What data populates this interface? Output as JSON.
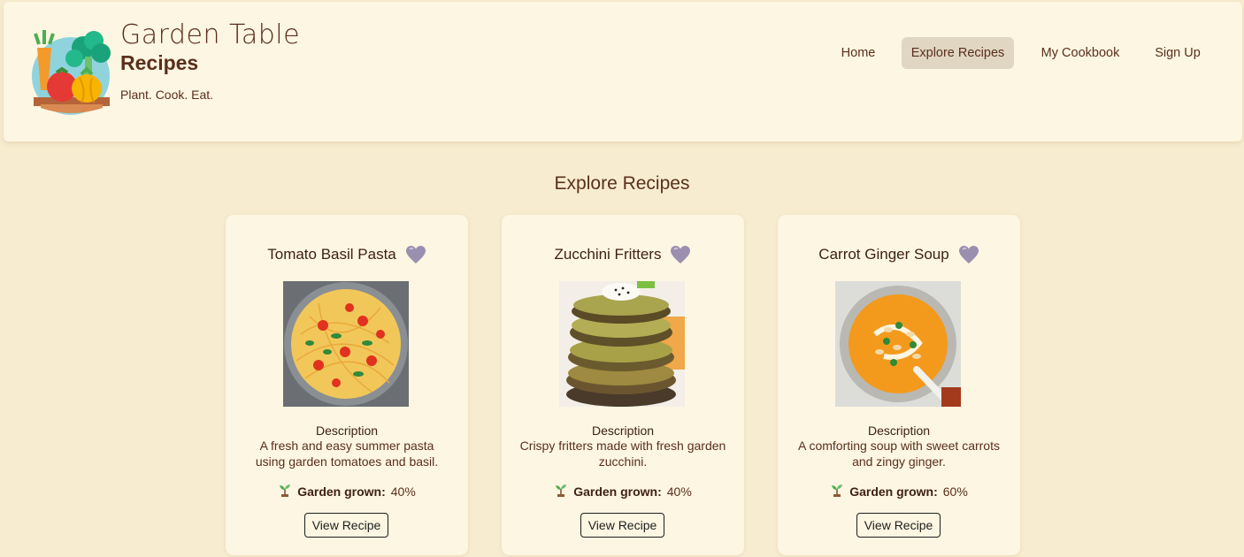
{
  "brand": {
    "title": "Garden Table",
    "subtitle": "Recipes",
    "tagline": "Plant. Cook. Eat."
  },
  "nav": [
    {
      "label": "Home",
      "active": false
    },
    {
      "label": "Explore Recipes",
      "active": true
    },
    {
      "label": "My Cookbook",
      "active": false
    },
    {
      "label": "Sign Up",
      "active": false
    }
  ],
  "page_title": "Explore Recipes",
  "cards": [
    {
      "title": "Tomato Basil Pasta",
      "desc_label": "Description",
      "description": "A fresh and easy summer pasta using garden tomatoes and basil.",
      "garden_label": "Garden grown:",
      "garden_value": "40%",
      "button": "View Recipe",
      "image": "pasta-photo"
    },
    {
      "title": "Zucchini Fritters",
      "desc_label": "Description",
      "description": "Crispy fritters made with fresh garden zucchini.",
      "garden_label": "Garden grown:",
      "garden_value": "40%",
      "button": "View Recipe",
      "image": "fritters-photo"
    },
    {
      "title": "Carrot Ginger Soup",
      "desc_label": "Description",
      "description": "A comforting soup with sweet carrots and zingy ginger.",
      "garden_label": "Garden grown:",
      "garden_value": "60%",
      "button": "View Recipe",
      "image": "soup-photo"
    }
  ],
  "colors": {
    "background": "#f7ecd0",
    "header": "#fdf6e2",
    "text": "#5a2f1c",
    "nav_active": "#e0d6c2",
    "heart": "#9b8fb0"
  }
}
